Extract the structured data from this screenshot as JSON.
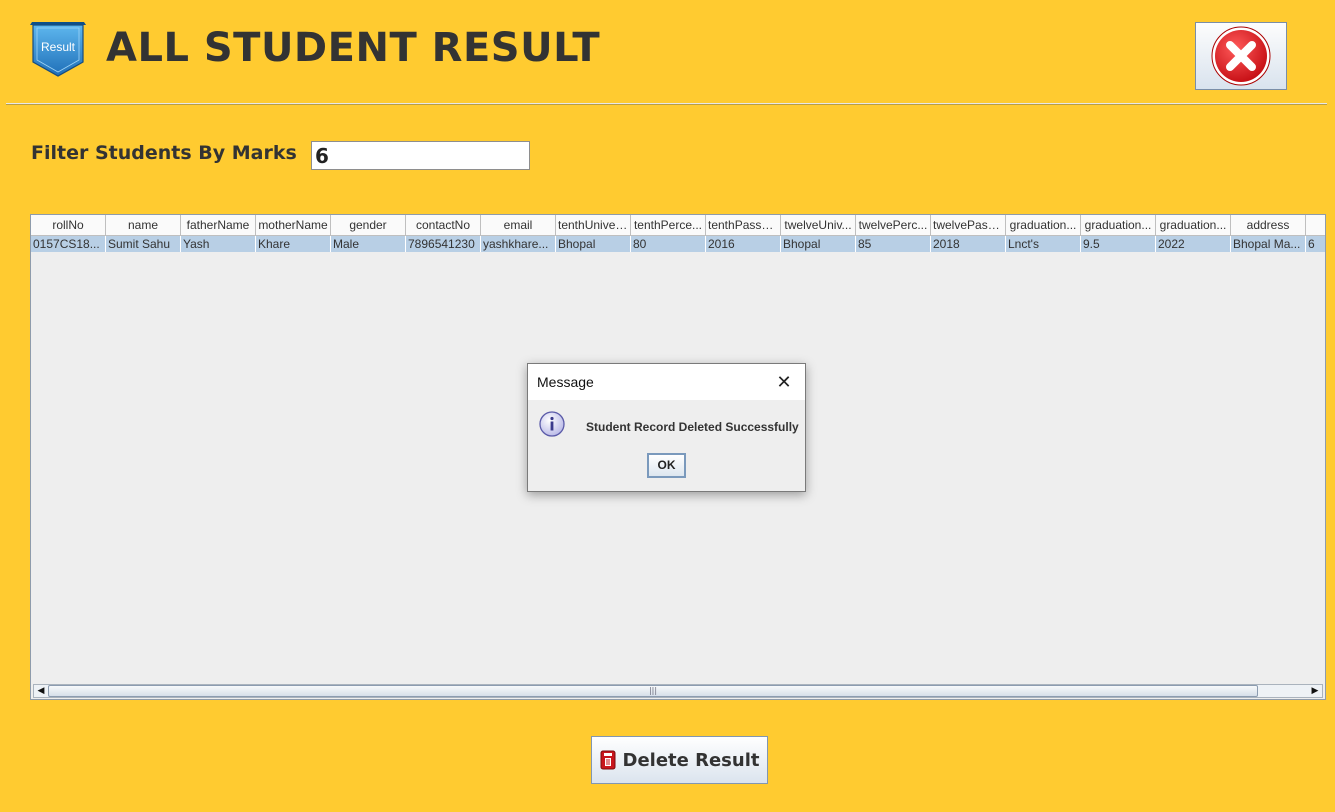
{
  "header": {
    "logo_text": "Result",
    "title": "ALL STUDENT RESULT"
  },
  "filter": {
    "label": "Filter Students By Marks",
    "value": "6"
  },
  "table": {
    "columns": [
      "rollNo",
      "name",
      "fatherName",
      "motherName",
      "gender",
      "contactNo",
      "email",
      "tenthUniver...",
      "tenthPerce...",
      "tenthPasso...",
      "twelveUniv...",
      "twelvePerc...",
      "twelvePass...",
      "graduation...",
      "graduation...",
      "graduation...",
      "address",
      ""
    ],
    "rows": [
      [
        "0157CS18...",
        "Sumit Sahu",
        "Yash",
        "Khare",
        "Male",
        "7896541230",
        "yashkhare...",
        "Bhopal",
        "80",
        "2016",
        "Bhopal",
        "85",
        "2018",
        "Lnct's",
        "9.5",
        "2022",
        "Bhopal Ma...",
        "6"
      ]
    ]
  },
  "dialog": {
    "title": "Message",
    "message": "Student Record Deleted Successfully",
    "ok_label": "OK"
  },
  "actions": {
    "delete_label": "Delete Result"
  },
  "colors": {
    "background": "#ffcb30",
    "selected_row": "#b8cfe5",
    "close_icon": "#e0161e"
  }
}
